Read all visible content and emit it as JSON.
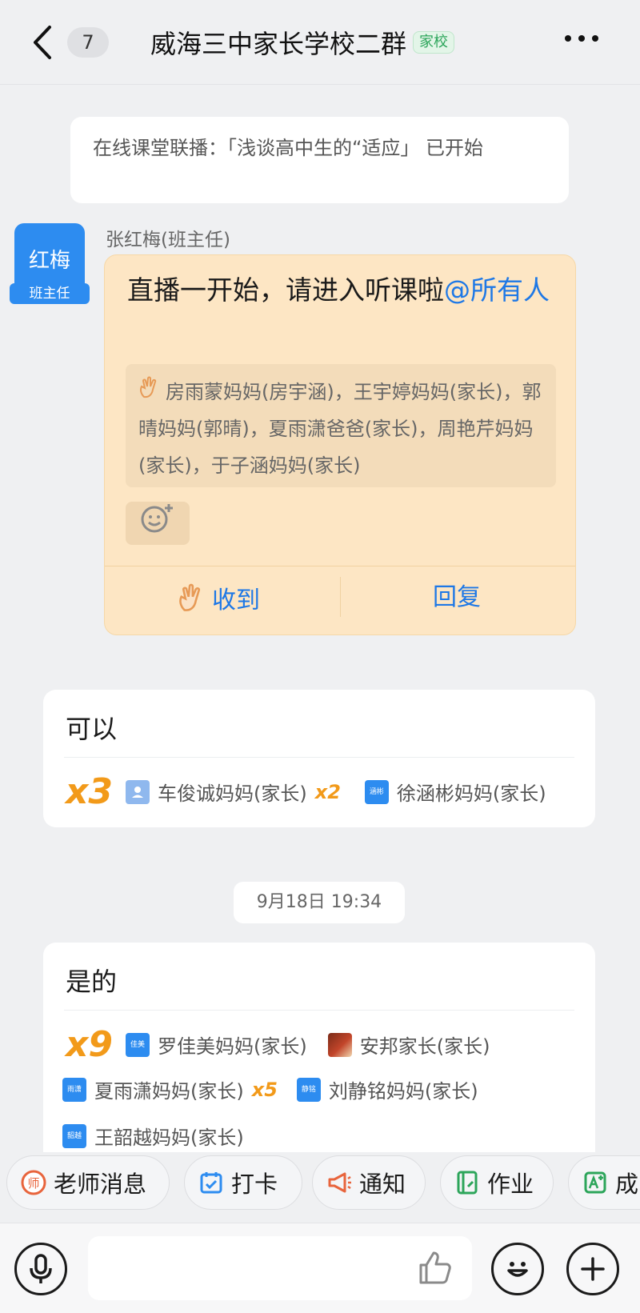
{
  "header": {
    "unread_count": "7",
    "title": "威海三中家长学校二群",
    "tag": "家校"
  },
  "system_notice": "在线课堂联播：「浅谈高中生的“适应」 已开始",
  "message": {
    "avatar_name": "红梅",
    "avatar_role": "班主任",
    "sender": "张红梅(班主任)",
    "text": "直播一开始，请进入听课啦",
    "mention": "@所有人",
    "acknowledged_by": "房雨蒙妈妈(房宇涵)，王宇婷妈妈(家长)，郭晴妈妈(郭晴)，夏雨潇爸爸(家长)，周艳芹妈妈(家长)，于子涵妈妈(家长)",
    "ack_label": "收到",
    "reply_label": "回复"
  },
  "reply1": {
    "text": "可以",
    "count": "x3",
    "people": [
      {
        "name": "车俊诚妈妈(家长)",
        "icon_text": "",
        "multiplier": "x2"
      },
      {
        "name": "徐涵彬妈妈(家长)",
        "icon_text": "涵彬",
        "multiplier": ""
      }
    ]
  },
  "timestamp": "9月18日 19:34",
  "reply2": {
    "text": "是的",
    "count": "x9",
    "people": [
      {
        "name": "罗佳美妈妈(家长)",
        "icon_text": "佳美",
        "multiplier": ""
      },
      {
        "name": "安邦家长(家长)",
        "icon_text": "",
        "multiplier": ""
      },
      {
        "name": "夏雨潇妈妈(家长)",
        "icon_text": "雨潇",
        "multiplier": "x5"
      },
      {
        "name": "刘静铭妈妈(家长)",
        "icon_text": "静铭",
        "multiplier": ""
      },
      {
        "name": "王韶越妈妈(家长)",
        "icon_text": "韶越",
        "multiplier": ""
      }
    ]
  },
  "quick_actions": [
    {
      "label": "老师消息",
      "icon": "teacher-msg-icon",
      "color": "#e8643c"
    },
    {
      "label": "打卡",
      "icon": "checkin-icon",
      "color": "#2d8cf0"
    },
    {
      "label": "通知",
      "icon": "megaphone-icon",
      "color": "#e8643c"
    },
    {
      "label": "作业",
      "icon": "homework-icon",
      "color": "#2ca55a"
    },
    {
      "label": "成",
      "icon": "grades-icon",
      "color": "#2ca55a"
    }
  ],
  "input": {
    "placeholder": ""
  },
  "colors": {
    "accent": "#1e78e6",
    "notice_bg": "#fde6c4",
    "multiplier": "#f29a1a"
  }
}
